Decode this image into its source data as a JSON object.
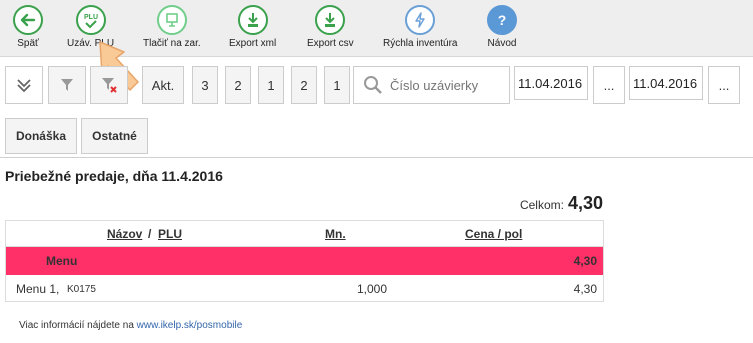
{
  "toolbar": {
    "buttons": [
      {
        "label": "Späť",
        "icon": "arrow-left-icon",
        "color": "#3aa14c"
      },
      {
        "label": "Uzáv. PLU",
        "icon": "plu-check-icon",
        "color": "#3aa14c"
      },
      {
        "label": "Tlačiť na zar.",
        "icon": "print-icon",
        "color": "#6fcf8a"
      },
      {
        "label": "Export xml",
        "icon": "download-xml-icon",
        "color": "#3aa14c"
      },
      {
        "label": "Export csv",
        "icon": "download-csv-icon",
        "color": "#3aa14c"
      },
      {
        "label": "Rýchla inventúra",
        "icon": "lightning-icon",
        "color": "#6a9fd6"
      },
      {
        "label": "Návod",
        "icon": "help-icon",
        "color": "#5b98d6"
      }
    ]
  },
  "filters": {
    "akt_label": "Akt.",
    "num_buttons": [
      "3",
      "2",
      "1",
      "2",
      "1"
    ],
    "search_placeholder": "Číslo uzávierky",
    "date_from": "11.04.2016",
    "date_to": "11.04.2016",
    "more_label": "..."
  },
  "tabs": [
    "Donáška",
    "Ostatné"
  ],
  "report": {
    "title": "Priebežné predaje, dňa 11.4.2016",
    "total_label": "Celkom:",
    "total_value": "4,30"
  },
  "table": {
    "col_name": "Názov",
    "col_sep": " / ",
    "col_plu": "PLU",
    "col_qty": "Mn.",
    "col_price": "Cena / pol",
    "group": {
      "name": "Menu",
      "price": "4,30"
    },
    "rows": [
      {
        "name": "Menu 1,",
        "plu": "K0175",
        "qty": "1,000",
        "price": "4,30"
      }
    ]
  },
  "footer": {
    "text": "Viac informácií nájdete na",
    "link": "www.ikelp.sk/posmobile"
  },
  "colors": {
    "accent_green": "#3aa14c",
    "group_row": "#ff2f68",
    "highlight_arrow": "#f6c08a"
  }
}
